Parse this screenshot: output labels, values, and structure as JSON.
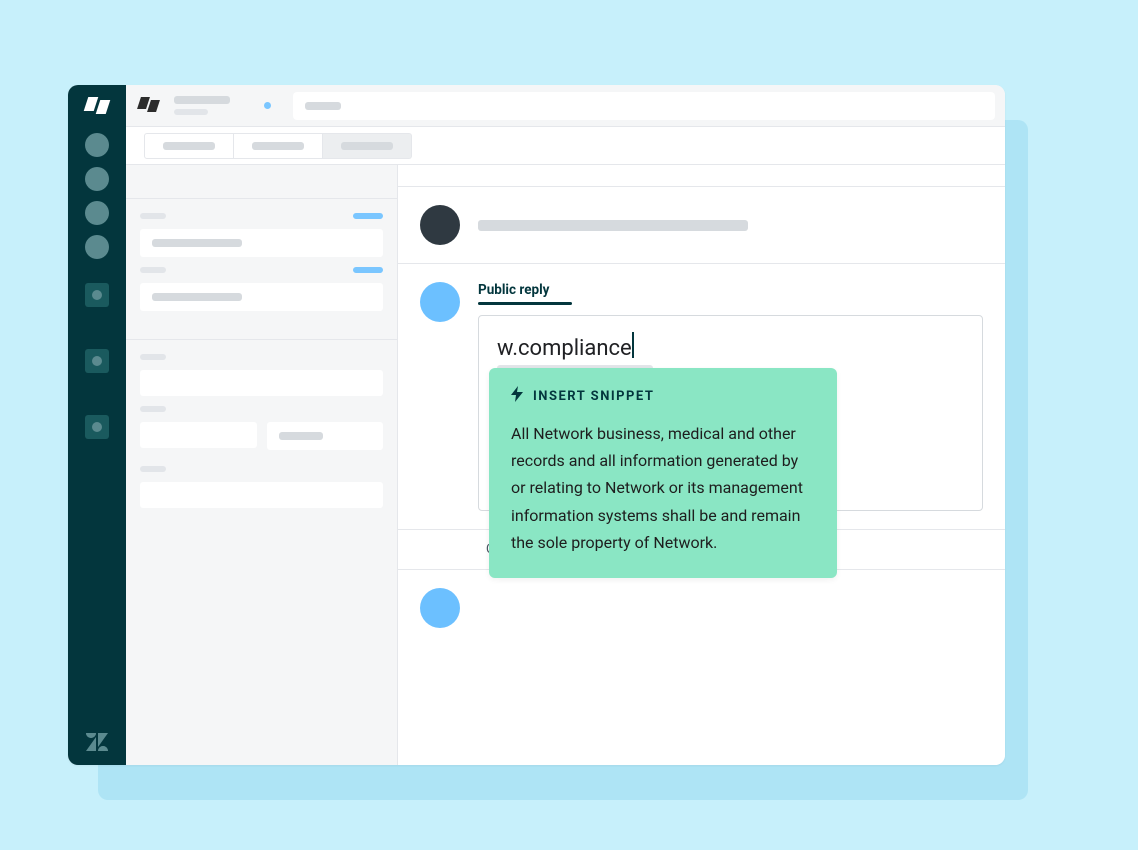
{
  "colors": {
    "page_bg": "#c7f0fb",
    "rail_bg": "#03363d",
    "accent_blue": "#6cc0ff",
    "snippet_bg": "#8ae6c4",
    "text_dark": "#03363d"
  },
  "rail": {
    "items": [
      {
        "name": "nav-overview"
      },
      {
        "name": "nav-tickets"
      },
      {
        "name": "nav-users"
      },
      {
        "name": "nav-reports"
      }
    ],
    "apps": [
      {
        "name": "app-1"
      },
      {
        "name": "app-2"
      },
      {
        "name": "app-3"
      }
    ],
    "brand": "zendesk"
  },
  "topbar": {
    "tab_indicator": true
  },
  "tabs": {
    "items": [
      {
        "active": false
      },
      {
        "active": false
      },
      {
        "active": true
      }
    ]
  },
  "conversation": {
    "reply_label": "Public reply",
    "input_text": "w.compliance",
    "collaborator_prefix": "Co",
    "snippet": {
      "header": "INSERT SNIPPET",
      "body": "All Network business, medical and other records and all information generated by or relating to Network or its management information systems shall be and remain the sole property of Network."
    }
  }
}
